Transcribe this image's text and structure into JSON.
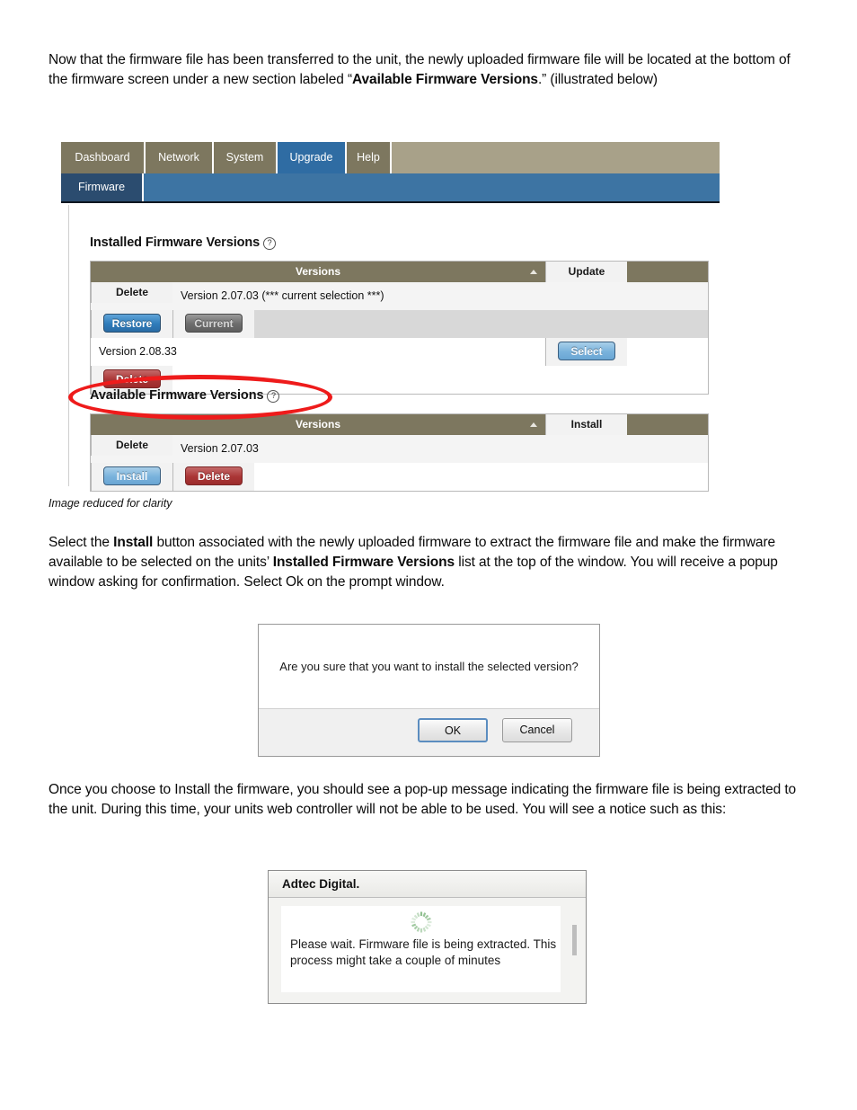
{
  "document": {
    "paragraph_1_part_1": "Now that the firmware file has been transferred to the unit, the newly uploaded firmware file will be located at the bottom of the firmware screen under a new section labeled “",
    "paragraph_1_bold": "Available Firmware Versions",
    "paragraph_1_part_2": ".” (illustrated below)",
    "image_caption": "Image reduced for clarity",
    "paragraph_2_part_1": "Select the ",
    "paragraph_2_bold_1": "Install",
    "paragraph_2_part_2": " button associated with the newly uploaded firmware to extract the firmware file and make the firmware available to be selected on the units’ ",
    "paragraph_2_bold_2": "Installed Firmware Versions",
    "paragraph_2_part_3": " list at the top of the window.  You will receive a popup window asking for confirmation.  Select Ok on the prompt window.",
    "paragraph_3": "Once you choose to Install the firmware, you should see a pop-up message indicating the firmware file is being extracted to the unit.  During this time, your units web controller will not be able to be used.  You will see a notice such as this:"
  },
  "web_ui": {
    "tabs": [
      {
        "label": "Dashboard",
        "active": false
      },
      {
        "label": "Network",
        "active": false
      },
      {
        "label": "System",
        "active": false
      },
      {
        "label": "Upgrade",
        "active": true
      },
      {
        "label": "Help",
        "active": false
      }
    ],
    "subtab": {
      "label": "Firmware",
      "active": true
    },
    "installed_section": {
      "title": "Installed Firmware Versions",
      "help_icon": "question-mark-circle-icon",
      "columns": [
        "Versions",
        "Update",
        "Delete"
      ],
      "sort_indicator": "sort-ascending-icon",
      "rows": [
        {
          "version": "Version 2.07.03 (*** current selection ***)",
          "update_button": "Restore",
          "update_style": "blue",
          "delete_button": "Current",
          "delete_style": "gray"
        },
        {
          "version": "Version 2.08.33",
          "update_button": "Select",
          "update_style": "blue-light",
          "delete_button": "Delete",
          "delete_style": "red"
        }
      ]
    },
    "available_section": {
      "title": "Available Firmware Versions",
      "help_icon": "question-mark-circle-icon",
      "columns": [
        "Versions",
        "Install",
        "Delete"
      ],
      "sort_indicator": "sort-ascending-icon",
      "rows": [
        {
          "version": "Version 2.07.03",
          "install_button": "Install",
          "install_style": "blue-light",
          "delete_button": "Delete",
          "delete_style": "red"
        }
      ]
    },
    "annotation": {
      "shape": "red-ellipse-highlight",
      "color": "#ee1b1b"
    }
  },
  "confirm_dialog": {
    "message": "Are you sure that you want to install the selected version?",
    "ok_label": "OK",
    "cancel_label": "Cancel"
  },
  "wait_dialog": {
    "title": "Adtec Digital.",
    "spinner": "loading-spinner-icon",
    "message": "Please wait. Firmware file is being extracted. This process might take a couple of minutes"
  },
  "colors": {
    "tab_inactive": "#7d775f",
    "tab_active": "#2f6ca3",
    "tab_strip_bg": "#a8a189",
    "subtab_bar": "#3d74a3",
    "subtab_active": "#2b4c6f",
    "table_header": "#7d775f",
    "annotation_red": "#ee1b1b",
    "spinner_green": "#8fbf8f"
  }
}
